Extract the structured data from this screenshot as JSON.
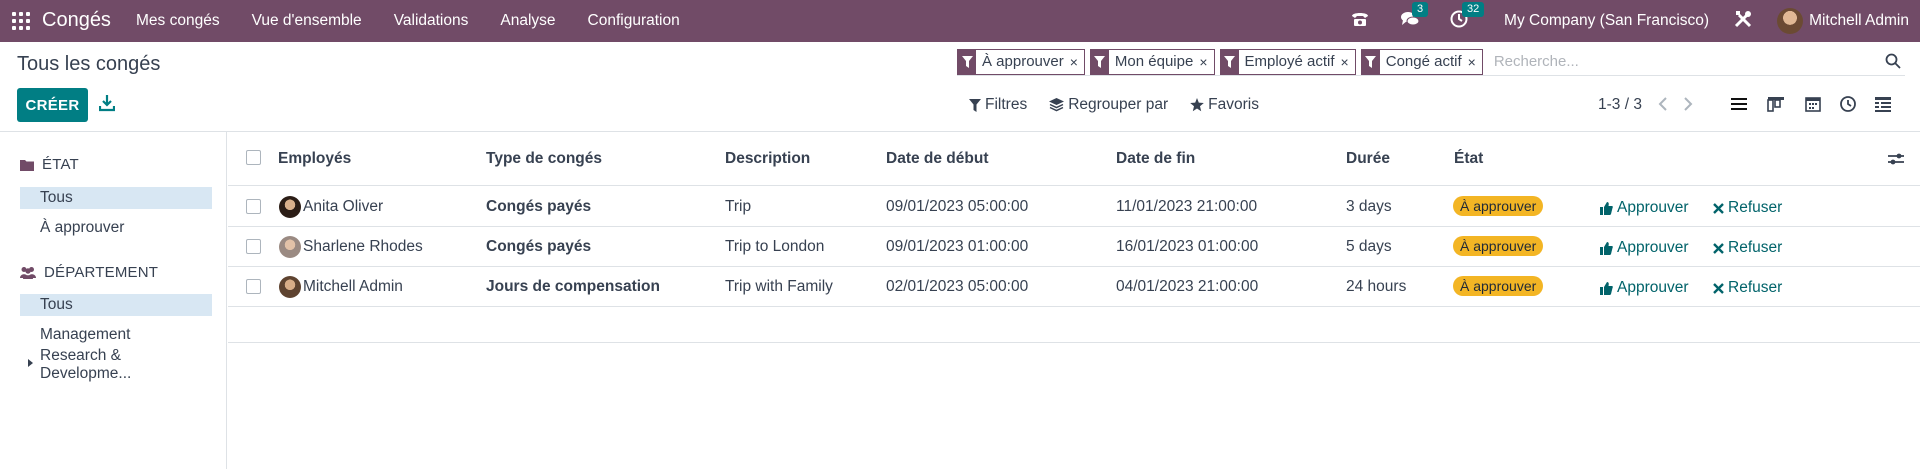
{
  "navbar": {
    "brand": "Congés",
    "menu": [
      "Mes congés",
      "Vue d'ensemble",
      "Validations",
      "Analyse",
      "Configuration"
    ],
    "messages_count": "3",
    "activities_count": "32",
    "company": "My Company (San Francisco)",
    "user": "Mitchell Admin"
  },
  "control_panel": {
    "title": "Tous les congés",
    "create_label": "CRÉER",
    "facets": [
      "À approuver",
      "Mon équipe",
      "Employé actif",
      "Congé actif"
    ],
    "facet_close": "×",
    "search_placeholder": "Recherche...",
    "filters_label": "Filtres",
    "groupby_label": "Regrouper par",
    "favorites_label": "Favoris",
    "pager": "1-3 / 3"
  },
  "sidebar": {
    "sections": [
      {
        "title": "ÉTAT",
        "items": [
          "Tous",
          "À approuver"
        ]
      },
      {
        "title": "DÉPARTEMENT",
        "items": [
          "Tous",
          "Management",
          "Research & Developme..."
        ]
      }
    ]
  },
  "table": {
    "headers": [
      "Employés",
      "Type de congés",
      "Description",
      "Date de début",
      "Date de fin",
      "Durée",
      "État"
    ],
    "rows": [
      {
        "employee": "Anita Oliver",
        "type": "Congés payés",
        "description": "Trip",
        "start": "09/01/2023 05:00:00",
        "end": "11/01/2023 21:00:00",
        "duration": "3 days",
        "state": "À approuver"
      },
      {
        "employee": "Sharlene Rhodes",
        "type": "Congés payés",
        "description": "Trip to London",
        "start": "09/01/2023 01:00:00",
        "end": "16/01/2023 01:00:00",
        "duration": "5 days",
        "state": "À approuver"
      },
      {
        "employee": "Mitchell Admin",
        "type": "Jours de compensation",
        "description": "Trip with Family",
        "start": "02/01/2023 05:00:00",
        "end": "04/01/2023 21:00:00",
        "duration": "24 hours",
        "state": "À approuver"
      }
    ],
    "approve_label": "Approuver",
    "refuse_label": "Refuser"
  },
  "colors": {
    "brand": "#714B67",
    "primary": "#017E84",
    "state_badge": "#F3B524",
    "selected_item": "#D8E7F3"
  }
}
